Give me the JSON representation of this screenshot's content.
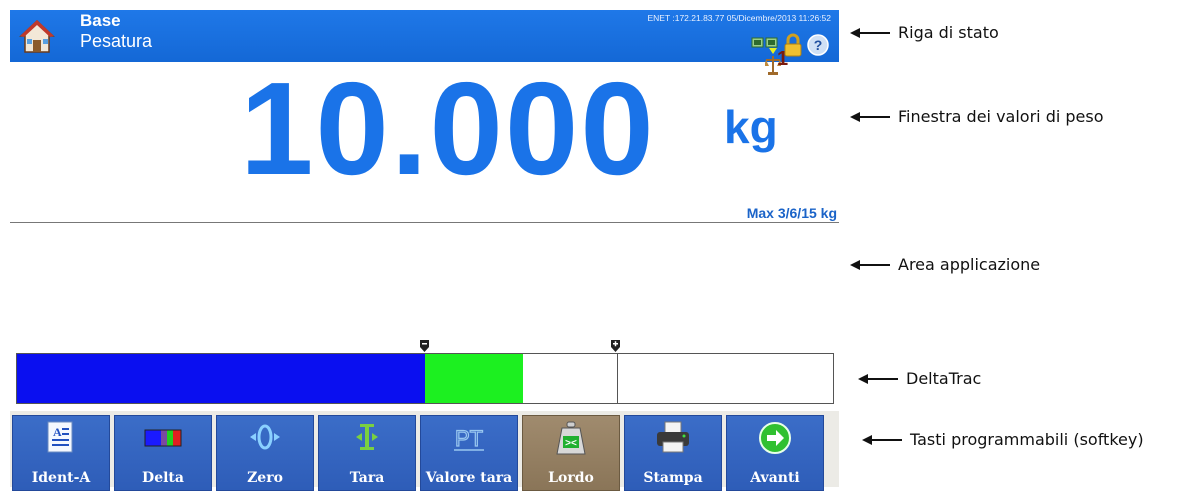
{
  "status_bar": {
    "title": "Base",
    "subtitle": "Pesatura",
    "network_info": "ENET :172.21.83.77  05/Dicembre/2013 11:26:52",
    "icons": [
      "network-icon",
      "lock-icon",
      "help-icon"
    ]
  },
  "weight": {
    "scale_number": "1",
    "value": "10.000",
    "unit": "kg",
    "capacity": "Max 3/6/15 kg"
  },
  "deltatrac": {
    "segments": [
      {
        "name": "under",
        "color": "#0a0ff0",
        "fraction": 0.5
      },
      {
        "name": "in-tolerance",
        "color": "#1cf020",
        "fraction": 0.12
      },
      {
        "name": "over",
        "color": "#ffffff",
        "fraction": 0.38
      }
    ],
    "marker_minus_fraction": 0.5,
    "marker_plus_fraction": 0.735
  },
  "softkeys": [
    {
      "label": "Ident-A",
      "icon": "ident-icon",
      "active": false
    },
    {
      "label": "Delta",
      "icon": "delta-bar-icon",
      "active": false
    },
    {
      "label": "Zero",
      "icon": "zero-icon",
      "active": false
    },
    {
      "label": "Tara",
      "icon": "tare-icon",
      "active": false
    },
    {
      "label": "Valore tara",
      "icon": "preset-tare-icon",
      "active": false
    },
    {
      "label": "Lordo",
      "icon": "gross-weight-icon",
      "active": true
    },
    {
      "label": "Stampa",
      "icon": "printer-icon",
      "active": false
    },
    {
      "label": "Avanti",
      "icon": "next-arrow-icon",
      "active": false
    }
  ],
  "annotations": {
    "status_line": "Riga di stato",
    "weight_window": "Finestra dei valori di peso",
    "application_area": "Area applicazione",
    "deltatrac": "DeltaTrac",
    "softkeys": "Tasti programmabili (softkey)"
  },
  "colors": {
    "status_bar": "#1a6fe0",
    "weight_text": "#1a73e8",
    "softkey": "#3464c0",
    "softkey_active": "#968062"
  }
}
